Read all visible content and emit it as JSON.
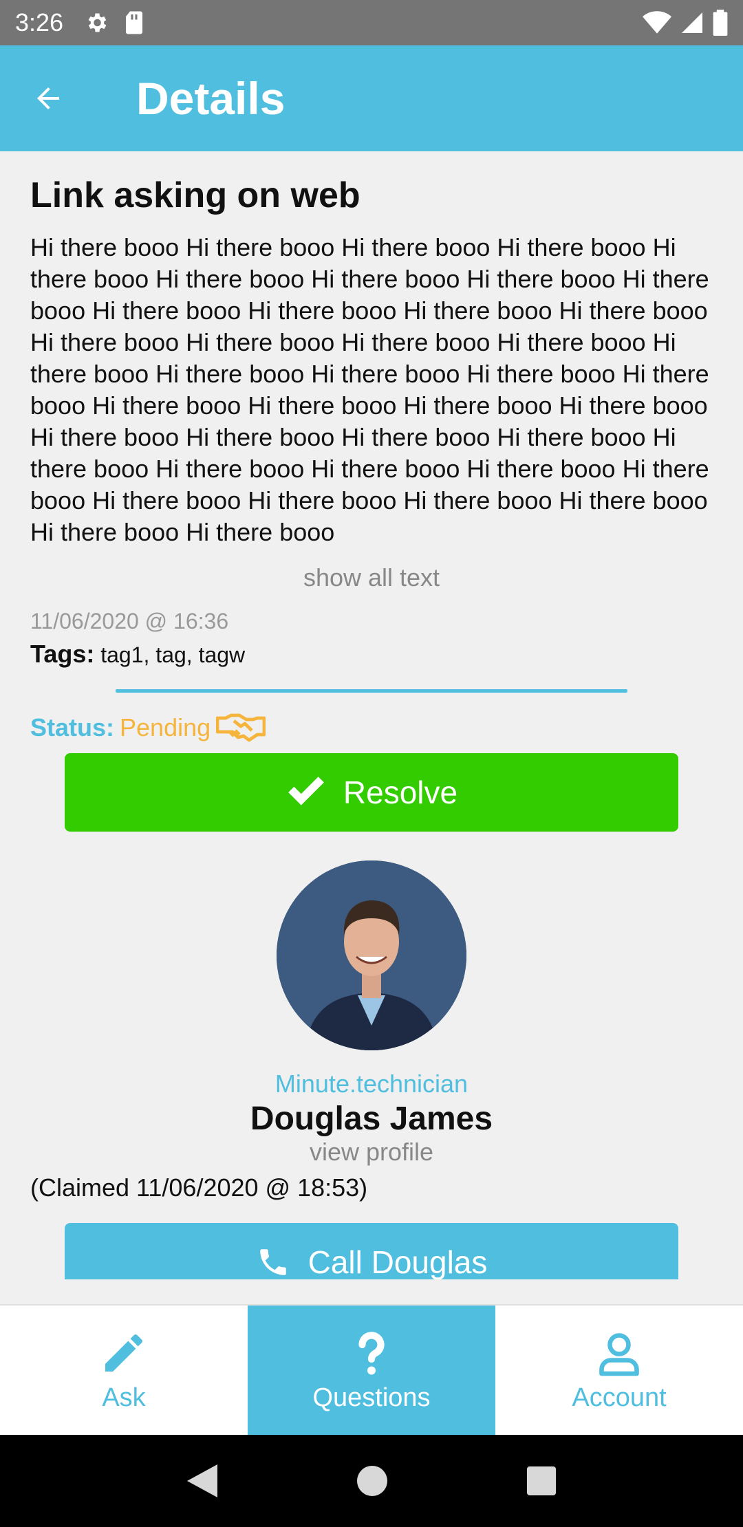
{
  "status_bar": {
    "time": "3:26"
  },
  "app_bar": {
    "title": "Details"
  },
  "question": {
    "title": "Link asking on web",
    "body": "Hi there booo Hi there booo Hi there booo Hi there booo Hi there booo Hi there booo Hi there booo Hi there booo Hi there booo Hi there booo Hi there booo Hi there booo Hi there booo Hi there booo Hi there booo Hi there booo Hi there booo Hi there booo Hi there booo Hi there booo Hi there booo Hi there booo Hi there booo Hi there booo Hi there booo Hi there booo Hi there booo Hi there booo Hi there booo Hi there booo Hi there booo Hi there booo Hi there booo Hi there booo Hi there booo Hi there booo Hi there booo Hi there booo Hi there booo Hi there booo Hi there booo",
    "show_all_label": "show all text",
    "date": "11/06/2020 @ 16:36",
    "tags_label": "Tags:",
    "tags": "tag1, tag, tagw"
  },
  "status": {
    "label": "Status:",
    "value": "Pending",
    "value_color": "#f5b43c",
    "icon": "handshake-icon"
  },
  "resolve_button": {
    "label": "Resolve",
    "color": "#33cc00"
  },
  "technician": {
    "role": "Minute.technician",
    "name": "Douglas James",
    "view_profile_label": "view profile",
    "claimed": "(Claimed 11/06/2020 @ 18:53)"
  },
  "call_button": {
    "label": "Call Douglas"
  },
  "bottom_nav": {
    "items": [
      {
        "label": "Ask",
        "icon": "pencil-icon"
      },
      {
        "label": "Questions",
        "icon": "question-icon"
      },
      {
        "label": "Account",
        "icon": "user-icon"
      }
    ],
    "active": "Questions"
  },
  "theme": {
    "accent": "#50bede"
  }
}
